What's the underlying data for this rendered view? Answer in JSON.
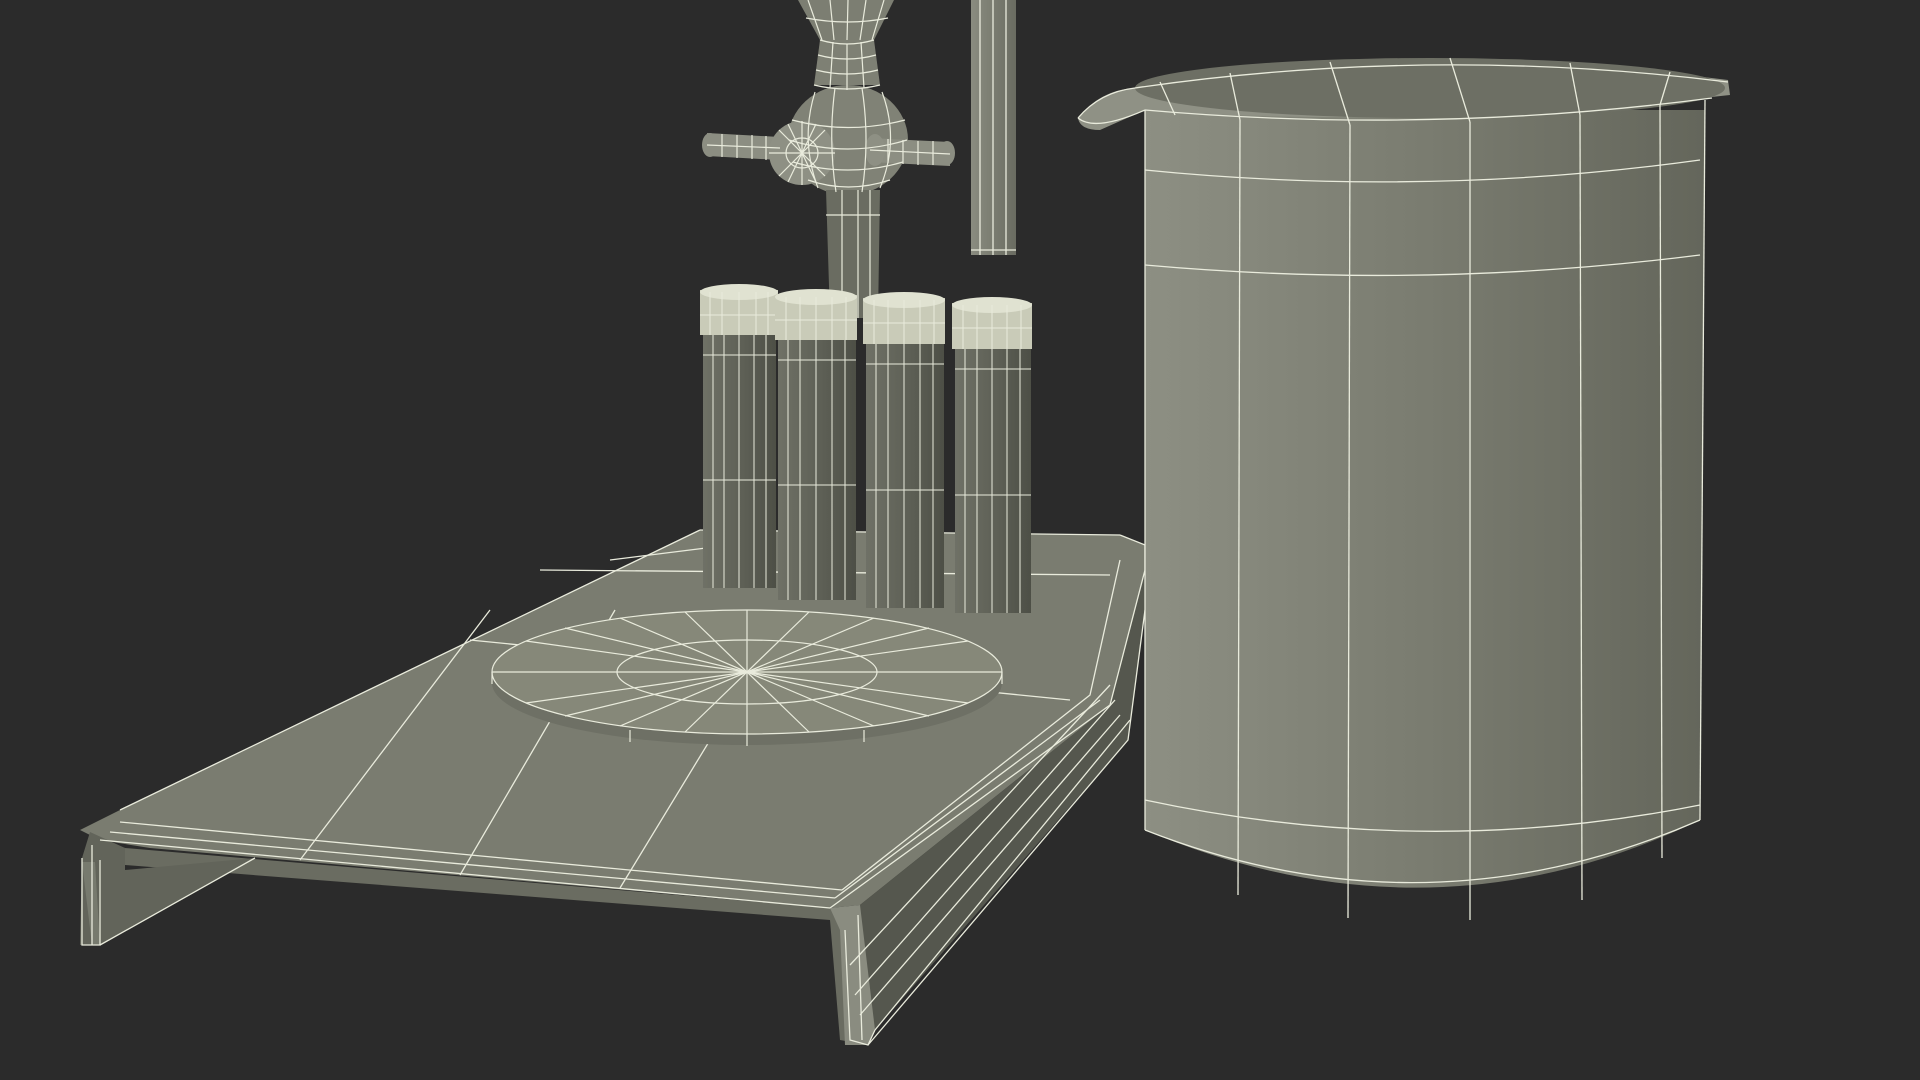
{
  "scene": {
    "background": "#2b2b2b",
    "surface_light": "#8a8c80",
    "surface_mid": "#75776b",
    "surface_dark": "#5e6056",
    "surface_shadow": "#4a4c43",
    "wire_color": "#e9ebdc",
    "objects": [
      "separatory-funnel-with-stopcock",
      "support-rod",
      "sample-vials",
      "base-plate",
      "round-pad",
      "beaker"
    ],
    "vial_count": 4
  }
}
